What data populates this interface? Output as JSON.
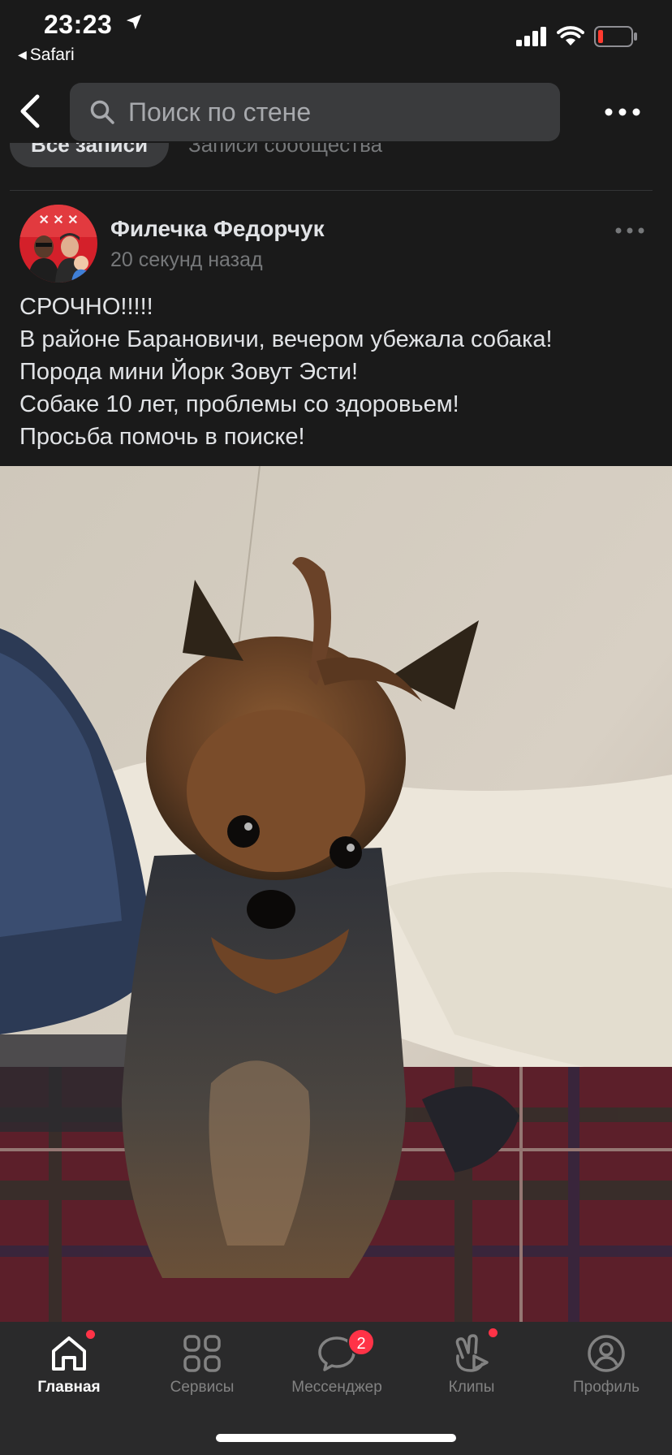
{
  "status_bar": {
    "time": "23:23",
    "back_app": "Safari"
  },
  "header": {
    "search_placeholder": "Поиск по стене"
  },
  "filters": {
    "active": "Все записи",
    "other": "Записи сообщества"
  },
  "post": {
    "author": "Филечка Федорчук",
    "time": "20 секунд назад",
    "lines": [
      "СРОЧНО!!!!!",
      "В районе Барановичи, вечером убежала собака!",
      "Порода мини Йорк Зовут Эсти!",
      "Собаке 10 лет, проблемы со здоровьем!",
      "Просьба помочь в поиске!"
    ]
  },
  "tabbar": {
    "items": [
      {
        "label": "Главная",
        "icon": "home-icon"
      },
      {
        "label": "Сервисы",
        "icon": "services-icon"
      },
      {
        "label": "Мессенджер",
        "icon": "messenger-icon",
        "badge": "2"
      },
      {
        "label": "Клипы",
        "icon": "clips-icon"
      },
      {
        "label": "Профиль",
        "icon": "profile-icon"
      }
    ]
  },
  "colors": {
    "background": "#1a1a1a",
    "tabbar": "#2a2a2b",
    "accent_red": "#ff3347",
    "secondary_text": "#76787a"
  }
}
